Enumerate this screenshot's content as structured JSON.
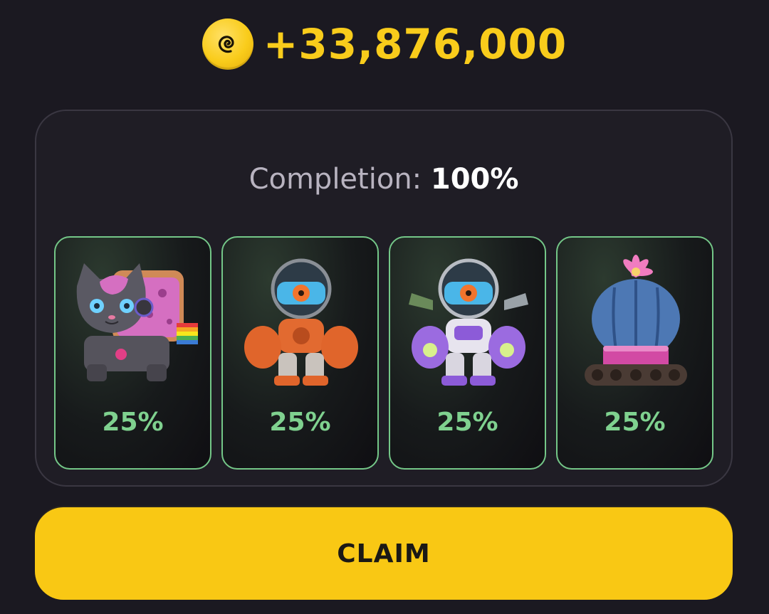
{
  "reward": {
    "icon": "coin-icon",
    "amount": "+33,876,000",
    "color": "#f9cc1b"
  },
  "completion": {
    "label": "Completion:",
    "value": "100%"
  },
  "cards": [
    {
      "name": "cat-robot",
      "icon": "cat-robot-icon",
      "percent": "25%"
    },
    {
      "name": "orange-mech",
      "icon": "orange-mech-icon",
      "percent": "25%"
    },
    {
      "name": "purple-mech",
      "icon": "purple-mech-icon",
      "percent": "25%"
    },
    {
      "name": "cactus-tank",
      "icon": "cactus-tank-icon",
      "percent": "25%"
    }
  ],
  "claim_button": {
    "label": "CLAIM",
    "color": "#f9c814"
  },
  "colors": {
    "background": "#1b1921",
    "card_border": "#74c788",
    "percent_text": "#7fd18f"
  }
}
